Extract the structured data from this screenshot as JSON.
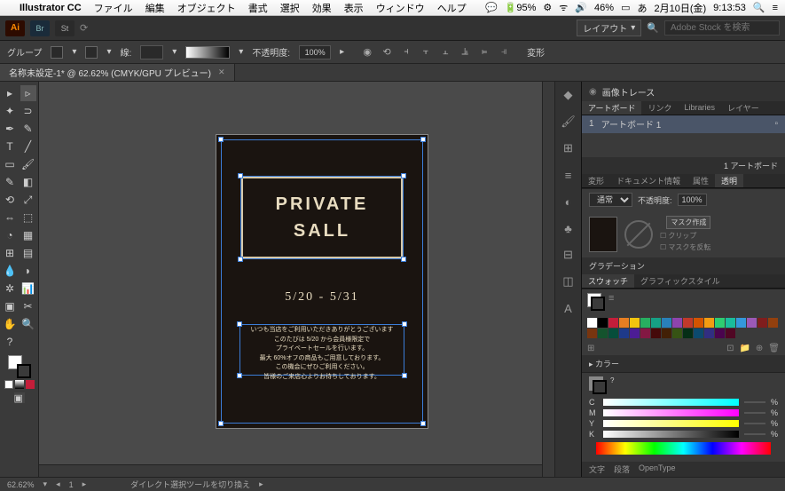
{
  "menubar": {
    "app": "Illustrator CC",
    "items": [
      "ファイル",
      "編集",
      "オブジェクト",
      "書式",
      "選択",
      "効果",
      "表示",
      "ウィンドウ",
      "ヘルプ"
    ],
    "battery": "46%",
    "mem": "95%",
    "date": "2月10日(金)",
    "time": "9:13:53"
  },
  "appbar": {
    "layout_label": "レイアウト",
    "search_placeholder": "Adobe Stock を検索"
  },
  "optbar": {
    "mode": "グループ",
    "stroke_label": "線:",
    "opacity_label": "不透明度:",
    "opacity_value": "100%",
    "transform": "変形"
  },
  "tab": {
    "title": "名称未設定-1* @ 62.62% (CMYK/GPU プレビュー)"
  },
  "canvas": {
    "title1": "PRIVATE",
    "title2": "SALL",
    "dates": "5/20 - 5/31",
    "body1": "いつも当店をご利用いただきありがとうございます",
    "body2": "このたびは 5/20 から会員様限定で",
    "body3": "プライベートセールを行います。",
    "body4": "最大 60%オフの商品もご用意しております。",
    "body5": "この機会にぜひご利用ください。",
    "body6": "皆様のご来店心よりお待ちしております。"
  },
  "panels": {
    "trace": "画像トレース",
    "tabs1": [
      "アートボード",
      "リンク",
      "Libraries",
      "レイヤー"
    ],
    "artboard_num": "1",
    "artboard_name": "アートボード 1",
    "artboard_count": "1 アートボード",
    "tabs2": [
      "変形",
      "ドキュメント情報",
      "属性",
      "透明"
    ],
    "blend": "通常",
    "opacity_label": "不透明度:",
    "opacity_val": "100%",
    "mask_btn": "マスク作成",
    "clip": "クリップ",
    "invert": "マスクを反転",
    "grad_title": "グラデーション",
    "tabs3": [
      "スウォッチ",
      "グラフィックスタイル"
    ],
    "color_title": "カラー",
    "c": "C",
    "m": "M",
    "y": "Y",
    "k": "K",
    "pct": "%",
    "footer": [
      "文字",
      "段落",
      "OpenType"
    ]
  },
  "swatches": [
    "#ffffff",
    "#000000",
    "#c41e3a",
    "#e67e22",
    "#f1c40f",
    "#27ae60",
    "#16a085",
    "#2980b9",
    "#8e44ad",
    "#c0392b",
    "#d35400",
    "#f39c12",
    "#2ecc71",
    "#1abc9c",
    "#3498db",
    "#9b59b6",
    "#7f1d1d",
    "#92400e",
    "#78350f",
    "#14532d",
    "#064e3b",
    "#1e3a8a",
    "#4c1d95",
    "#831843",
    "#450a0a",
    "#422006",
    "#365314",
    "#052e16",
    "#0c4a6e",
    "#312e81",
    "#4a044e",
    "#500724"
  ],
  "status": {
    "zoom": "62.62%",
    "tool_hint": "ダイレクト選択ツールを切り換え"
  }
}
